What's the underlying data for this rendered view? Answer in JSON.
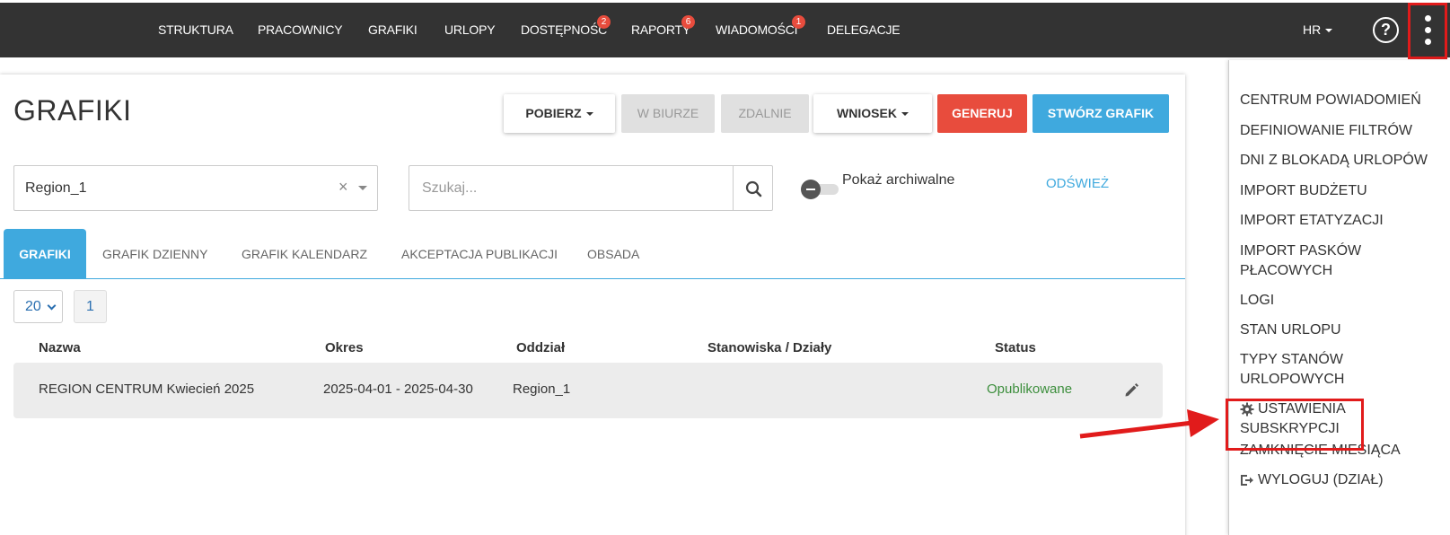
{
  "nav": {
    "items": [
      {
        "label": "STRUKTURA"
      },
      {
        "label": "PRACOWNICY"
      },
      {
        "label": "GRAFIKI"
      },
      {
        "label": "URLOPY"
      },
      {
        "label": "DOSTĘPNOŚĆ",
        "badge": "2"
      },
      {
        "label": "RAPORTY",
        "badge": "6"
      },
      {
        "label": "WIADOMOŚCI",
        "badge": "1"
      },
      {
        "label": "DELEGACJE"
      }
    ],
    "user_menu": "HR",
    "help_icon": "?"
  },
  "page": {
    "title": "GRAFIKI",
    "buttons": {
      "download": "POBIERZ",
      "office": "W BIURZE",
      "remote": "ZDALNIE",
      "request": "WNIOSEK",
      "generate": "GENERUJ",
      "create": "STWÓRZ GRAFIK"
    },
    "region_select": "Region_1",
    "region_clear": "×",
    "search_placeholder": "Szukaj...",
    "archive_toggle_label": "Pokaż archiwalne",
    "refresh_label": "ODŚWIEŻ"
  },
  "tabs": [
    {
      "label": "GRAFIKI",
      "active": true
    },
    {
      "label": "GRAFIK DZIENNY"
    },
    {
      "label": "GRAFIK KALENDARZ"
    },
    {
      "label": "AKCEPTACJA PUBLIKACJI"
    },
    {
      "label": "OBSADA"
    }
  ],
  "pagination": {
    "page_size": "20",
    "current_page": "1"
  },
  "table": {
    "headers": [
      "Nazwa",
      "Okres",
      "Oddział",
      "Stanowiska / Działy",
      "Status"
    ],
    "rows": [
      {
        "name": "REGION CENTRUM Kwiecień 2025",
        "period": "2025-04-01 - 2025-04-30",
        "branch": "Region_1",
        "positions": "",
        "status": "Opublikowane"
      }
    ]
  },
  "menu": {
    "items": [
      {
        "label": "CENTRUM POWIADOMIEŃ"
      },
      {
        "label": "DEFINIOWANIE FILTRÓW"
      },
      {
        "label": "DNI Z BLOKADĄ URLOPÓW"
      },
      {
        "label": "IMPORT BUDŻETU"
      },
      {
        "label": "IMPORT ETATYZACJI"
      },
      {
        "label": "IMPORT PASKÓW\nPŁACOWYCH"
      },
      {
        "label": "LOGI"
      },
      {
        "label": "STAN URLOPU"
      },
      {
        "label": "TYPY STANÓW\nURLOPOWYCH"
      },
      {
        "label": "USTAWIENIA\nSUBSKRYPCJI",
        "icon": "gear-icon"
      },
      {
        "label": "ZAMKNIĘCIE MIESIĄCA"
      },
      {
        "label": "WYLOGUJ (DZIAŁ)",
        "icon": "logout-icon"
      }
    ]
  },
  "colors": {
    "topbar": "#333333",
    "accent_blue": "#3fa9de",
    "danger_red": "#e84c3d",
    "annotation_red": "#e11b1b",
    "status_green": "#3c8e3c"
  }
}
